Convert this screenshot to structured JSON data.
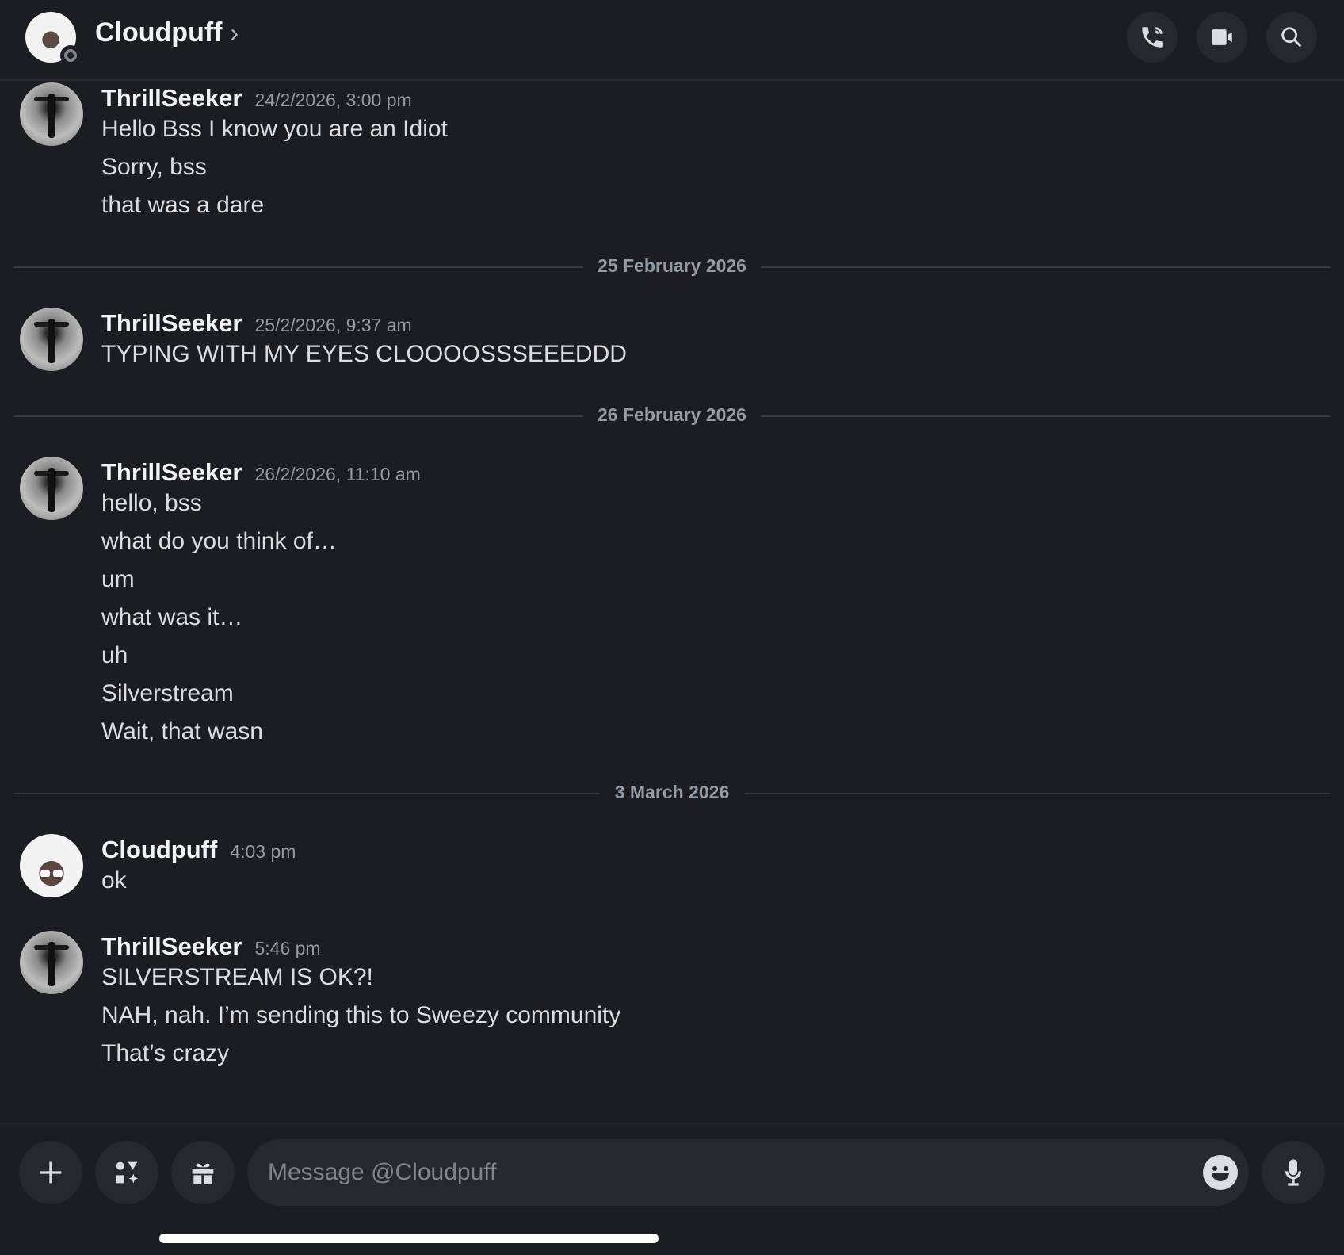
{
  "header": {
    "title": "Cloudpuff",
    "chevron": "›",
    "call_icon": "phone-icon",
    "video_icon": "video-camera-icon",
    "search_icon": "search-icon"
  },
  "messages": [
    {
      "author": "ThrillSeeker",
      "time": "24/2/2026, 3:00 pm",
      "lines": [
        "Hello Bss I know you are an Idiot",
        "Sorry, bss",
        "that was a dare"
      ]
    },
    {
      "divider": "25 February 2026"
    },
    {
      "author": "ThrillSeeker",
      "time": "25/2/2026, 9:37 am",
      "lines": [
        "TYPING WITH MY EYES CLOOOOSSSEEEDDD"
      ]
    },
    {
      "divider": "26 February 2026"
    },
    {
      "author": "ThrillSeeker",
      "time": "26/2/2026, 11:10 am",
      "lines": [
        "hello, bss",
        "what do you think of…",
        "um",
        "what was it…",
        "uh",
        "Silverstream",
        "Wait, that wasn"
      ]
    },
    {
      "divider": "3 March 2026"
    },
    {
      "author": "Cloudpuff",
      "time": "4:03 pm",
      "lines": [
        "ok"
      ]
    },
    {
      "author": "ThrillSeeker",
      "time": "5:46 pm",
      "lines": [
        "SILVERSTREAM IS OK?!",
        "NAH, nah. I’m sending this to Sweezy community",
        "That’s crazy"
      ]
    }
  ],
  "composer": {
    "placeholder": "Message @Cloudpuff",
    "value": "",
    "add_icon": "plus-icon",
    "apps_icon": "apps-icon",
    "gift_icon": "gift-icon",
    "emoji_icon": "emoji-icon",
    "mic_icon": "microphone-icon"
  },
  "colors": {
    "background": "#1c1d22",
    "button_bg": "#26282e",
    "text": "#dbdee1",
    "muted": "#949ba4"
  }
}
